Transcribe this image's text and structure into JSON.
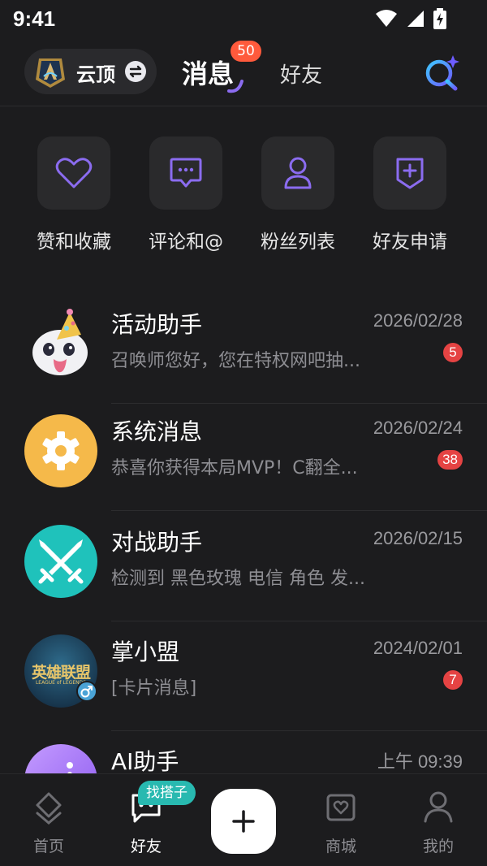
{
  "status_bar": {
    "time": "9:41"
  },
  "header": {
    "game_name": "云顶",
    "tab_messages": "消息",
    "tab_messages_badge": "50",
    "tab_friends": "好友"
  },
  "quick_actions": [
    {
      "label": "赞和收藏",
      "icon": "heart-icon"
    },
    {
      "label": "评论和@",
      "icon": "comment-icon"
    },
    {
      "label": "粉丝列表",
      "icon": "person-icon"
    },
    {
      "label": "好友申请",
      "icon": "add-friend-icon"
    }
  ],
  "messages": [
    {
      "title": "活动助手",
      "date": "2026/02/28",
      "preview": "召唤师您好，您在特权网吧抽...",
      "badge": "5"
    },
    {
      "title": "系统消息",
      "date": "2026/02/24",
      "preview": "恭喜你获得本局MVP！C翻全...",
      "badge": "38"
    },
    {
      "title": "对战助手",
      "date": "2026/02/15",
      "preview": "检测到 黑色玫瑰 电信 角色 发...",
      "badge": ""
    },
    {
      "title": "掌小盟",
      "date": "2024/02/01",
      "preview": "[卡片消息]",
      "badge": "7",
      "avatar_text": "英雄联盟",
      "avatar_subtext": "LEAGUE of LEGENDS"
    },
    {
      "title": "AI助手",
      "date": "上午 09:39",
      "preview": "",
      "badge": ""
    }
  ],
  "bottom_nav": {
    "home": "首页",
    "friends": "好友",
    "friends_badge": "找搭子",
    "shop": "商城",
    "me": "我的"
  },
  "colors": {
    "background": "#1c1c1e",
    "accent_purple": "#8b6cf0",
    "badge_red": "#e54343",
    "system_yellow": "#f5b94a",
    "battle_teal": "#1fc2bb",
    "find_badge": "#28b9b0"
  }
}
